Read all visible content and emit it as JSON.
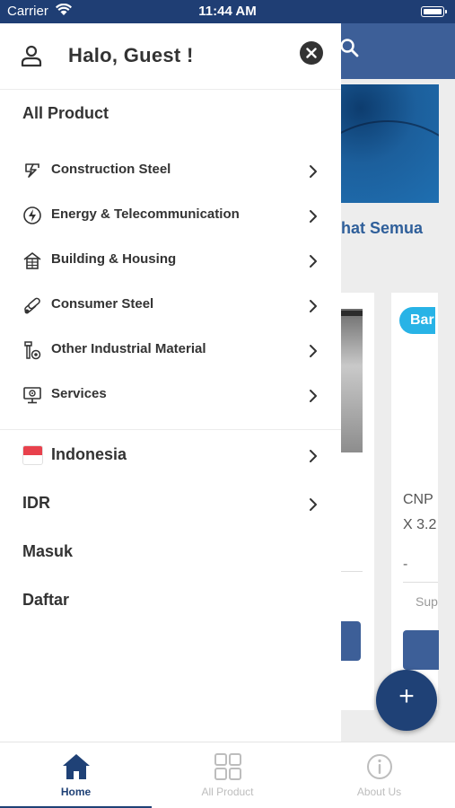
{
  "status_bar": {
    "carrier": "Carrier",
    "time": "11:44 AM"
  },
  "background": {
    "see_all": "hat Semua",
    "badge": "Bar",
    "product_line1": "CNP",
    "product_line2": "X 3.2",
    "price": "-",
    "supplier": "Sup",
    "fab_label": "+"
  },
  "drawer": {
    "greeting": "Halo, Guest !",
    "all_product": "All Product",
    "categories": [
      {
        "label": "Construction Steel",
        "icon": "construction-steel-icon"
      },
      {
        "label": "Energy & Telecommunication",
        "icon": "energy-icon"
      },
      {
        "label": "Building & Housing",
        "icon": "building-icon"
      },
      {
        "label": "Consumer Steel",
        "icon": "consumer-steel-icon"
      },
      {
        "label": "Other Industrial Material",
        "icon": "industrial-material-icon"
      },
      {
        "label": "Services",
        "icon": "services-icon"
      }
    ],
    "language": "Indonesia",
    "currency": "IDR",
    "login": "Masuk",
    "register": "Daftar"
  },
  "tabbar": {
    "tabs": [
      {
        "label": "Home",
        "icon": "home-icon",
        "active": true
      },
      {
        "label": "All Product",
        "icon": "grid-icon",
        "active": false
      },
      {
        "label": "About Us",
        "icon": "info-icon",
        "active": false
      }
    ]
  },
  "colors": {
    "primary": "#1f4176",
    "header_blue": "#3d5f98",
    "badge": "#28b3e6",
    "flag_red": "#e8414c"
  }
}
